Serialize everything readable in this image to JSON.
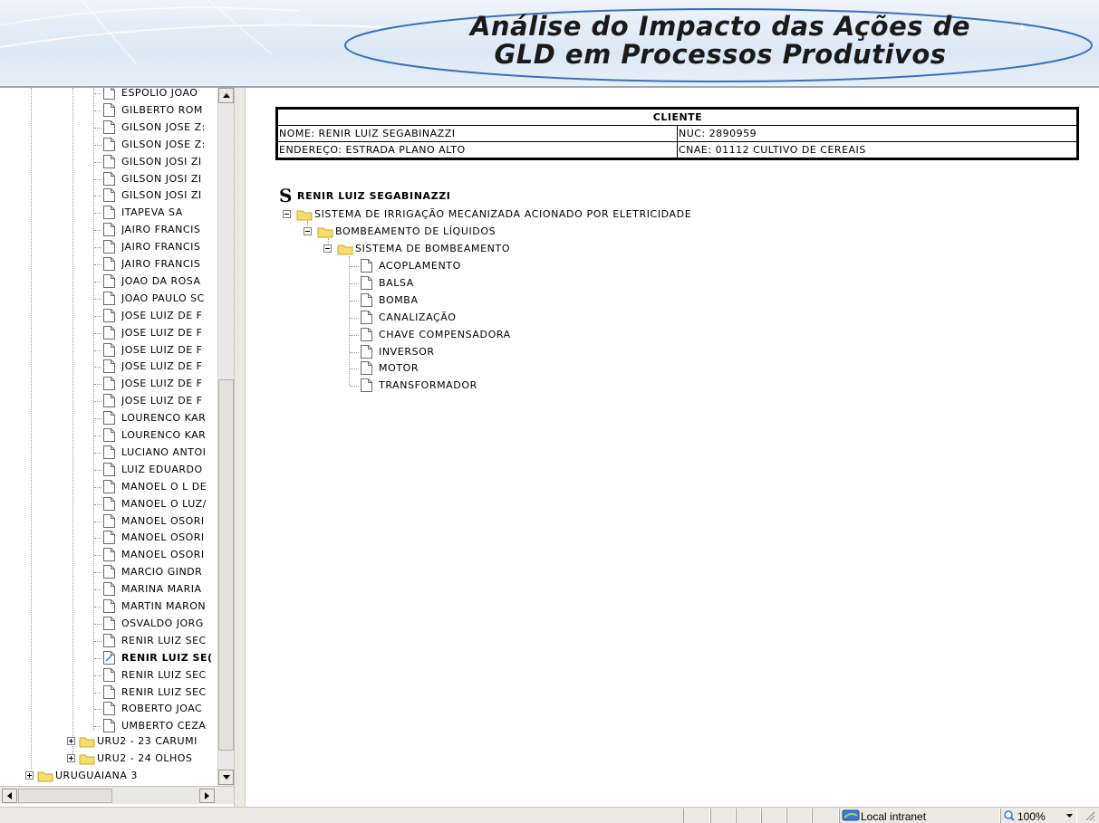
{
  "header": {
    "title_line1": "Análise do Impacto das Ações de",
    "title_line2": "GLD em Processos Produtivos"
  },
  "left_tree": {
    "clients": [
      "ESPOLIO JOAO",
      "GILBERTO ROM",
      "GILSON JOSE Z:",
      "GILSON JOSE Z:",
      "GILSON JOSI ZI",
      "GILSON JOSI ZI",
      "GILSON JOSI ZI",
      "ITAPEVA SA",
      "JAIRO FRANCIS",
      "JAIRO FRANCIS",
      "JAIRO FRANCIS",
      "JOAO DA ROSA",
      "JOAO PAULO SC",
      "JOSE LUIZ DE F",
      "JOSE LUIZ DE F",
      "JOSE LUIZ DE F",
      "JOSE LUIZ DE F",
      "JOSE LUIZ DE F",
      "JOSE LUIZ DE F",
      "LOURENCO KAR",
      "LOURENCO KAR",
      "LUCIANO ANTOI",
      "LUIZ EDUARDO",
      "MANOEL O L DE",
      "MANOEL O LUZ/",
      "MANOEL OSORI",
      "MANOEL OSORI",
      "MANOEL OSORI",
      "MARCIO GINDR",
      "MARINA MARIA",
      "MARTIN MARON",
      "OSVALDO JORG",
      "RENIR LUIZ SEC",
      "RENIR LUIZ SE(",
      "RENIR LUIZ SEC",
      "RENIR LUIZ SEC",
      "ROBERTO JOAC",
      "UMBERTO CEZA"
    ],
    "selected_index": 33,
    "folders": [
      "URU2 - 23 CARUMI",
      "URU2 - 24 OLHOS"
    ],
    "root_folder": "URUGUAIANA 3"
  },
  "client": {
    "header": "CLIENTE",
    "nome": "NOME: RENIR LUIZ SEGABINAZZI",
    "nuc": "NUC: 2890959",
    "endereco": "ENDEREÇO: ESTRADA PLANO ALTO",
    "cnae": "CNAE: 01112 CULTIVO DE CEREAIS"
  },
  "right_tree": {
    "root_label": "RENIR LUIZ SEGABINAZZI",
    "system": "SISTEMA DE IRRIGAÇÃO MECANIZADA ACIONADO POR ELETRICIDADE",
    "subsystem": "BOMBEAMENTO DE LÍQUIDOS",
    "subsubsystem": "SISTEMA DE BOMBEAMENTO",
    "components": [
      "ACOPLAMENTO",
      "BALSA",
      "BOMBA",
      "CANALIZAÇÃO",
      "CHAVE COMPENSADORA",
      "INVERSOR",
      "MOTOR",
      "TRANSFORMADOR"
    ]
  },
  "statusbar": {
    "zone": "Local intranet",
    "zoom": "100%"
  },
  "icons": {
    "root": "s-logo-icon",
    "folder": "folder-icon",
    "document": "document-icon",
    "expand": "plus-icon",
    "collapse": "minus-icon"
  }
}
